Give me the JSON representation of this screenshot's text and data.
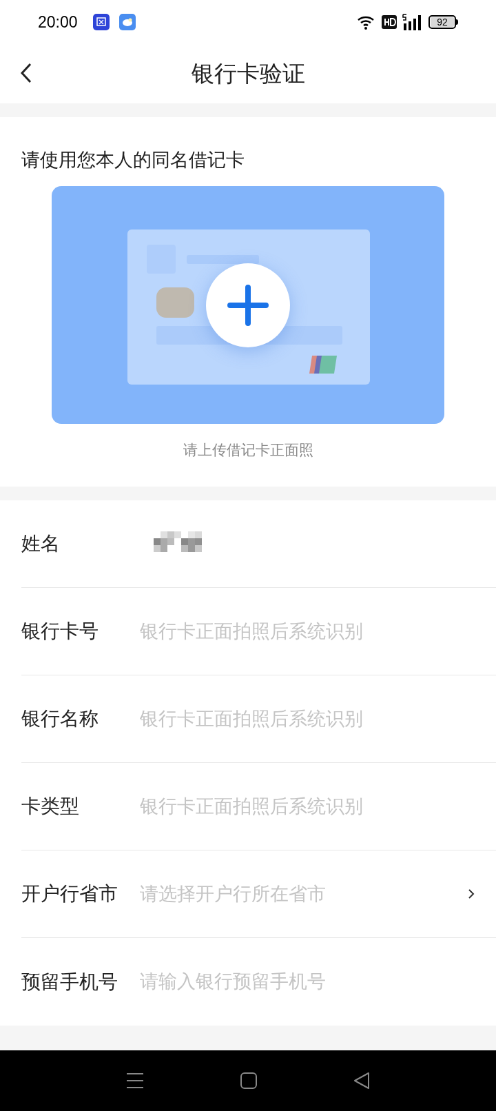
{
  "status_bar": {
    "time": "20:00",
    "battery": "92"
  },
  "header": {
    "title": "银行卡验证"
  },
  "upload": {
    "heading": "请使用您本人的同名借记卡",
    "caption": "请上传借记卡正面照"
  },
  "rows": [
    {
      "label": "姓名",
      "kind": "blurred"
    },
    {
      "label": "银行卡号",
      "kind": "field",
      "placeholder": "银行卡正面拍照后系统识别"
    },
    {
      "label": "银行名称",
      "kind": "field",
      "placeholder": "银行卡正面拍照后系统识别"
    },
    {
      "label": "卡类型",
      "kind": "field",
      "placeholder": "银行卡正面拍照后系统识别"
    },
    {
      "label": "开户行省市",
      "kind": "select",
      "placeholder": "请选择开户行所在省市"
    },
    {
      "label": "预留手机号",
      "kind": "field",
      "placeholder": "请输入银行预留手机号"
    }
  ]
}
